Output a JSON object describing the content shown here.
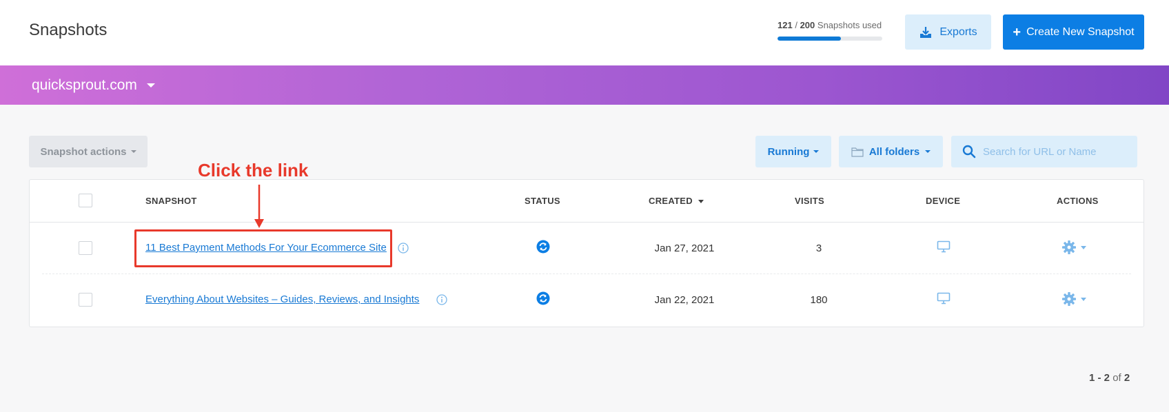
{
  "header": {
    "title": "Snapshots",
    "usage": {
      "used": "121",
      "total": "200",
      "suffix": "Snapshots used",
      "fraction": 0.605
    },
    "exports_label": "Exports",
    "create_label": "Create New Snapshot"
  },
  "site_bar": {
    "site": "quicksprout.com"
  },
  "toolbar": {
    "snapshot_actions_label": "Snapshot actions",
    "running_label": "Running",
    "folders_label": "All folders",
    "search_placeholder": "Search for URL or Name"
  },
  "table": {
    "columns": [
      "SNAPSHOT",
      "STATUS",
      "CREATED",
      "VISITS",
      "DEVICE",
      "ACTIONS"
    ],
    "rows": [
      {
        "name": "11 Best Payment Methods For Your Ecommerce Site",
        "created": "Jan 27, 2021",
        "visits": "3",
        "status_icon": "refresh-icon",
        "device_icon": "desktop-icon"
      },
      {
        "name": "Everything About Websites – Guides, Reviews, and Insights",
        "created": "Jan 22, 2021",
        "visits": "180",
        "status_icon": "refresh-icon",
        "device_icon": "desktop-icon"
      }
    ]
  },
  "annotation": {
    "text": "Click the link",
    "color": "#e8392b"
  },
  "pagination": {
    "range": "1 - 2",
    "of_label": "of",
    "total": "2"
  },
  "colors": {
    "primary": "#0c7ee4",
    "link": "#1879d4",
    "light_blue": "#dceefb",
    "purple_start": "#cf6fd8",
    "purple_end": "#8146c6"
  }
}
